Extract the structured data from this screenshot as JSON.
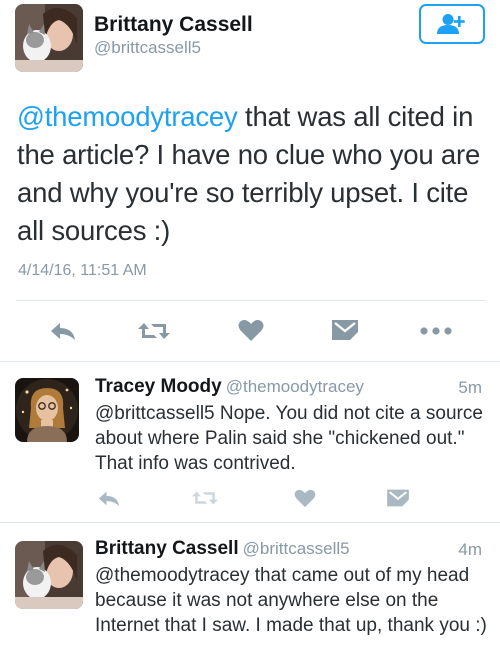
{
  "colors": {
    "accent": "#1da1f2",
    "muted": "#8899a6",
    "text": "#292f33",
    "divider": "#e1e8ed",
    "liked_icon": "#aab8c2"
  },
  "main_tweet": {
    "author_name": "Brittany Cassell",
    "author_handle": "@brittcassell5",
    "mention": "@themoodytracey",
    "body": " that was all cited in the article? I have no clue who you are and why you're so terribly upset. I cite all sources :)",
    "timestamp": "4/14/16, 11:51 AM",
    "follow_icon": "add-user-icon",
    "actions": [
      "reply-icon",
      "retweet-icon",
      "like-icon",
      "message-icon",
      "more-icon"
    ]
  },
  "replies": [
    {
      "author_name": "Tracey Moody",
      "author_handle": "@themoodytracey",
      "time": "5m",
      "body": "@brittcassell5 Nope. You did not cite a source about where Palin said she \"chickened out.\" That info was contrived."
    },
    {
      "author_name": "Brittany Cassell",
      "author_handle": "@brittcassell5",
      "time": "4m",
      "body": "@themoodytracey that came out of my head because it was not anywhere else on the Internet that I saw. I made that up, thank you :)"
    }
  ]
}
